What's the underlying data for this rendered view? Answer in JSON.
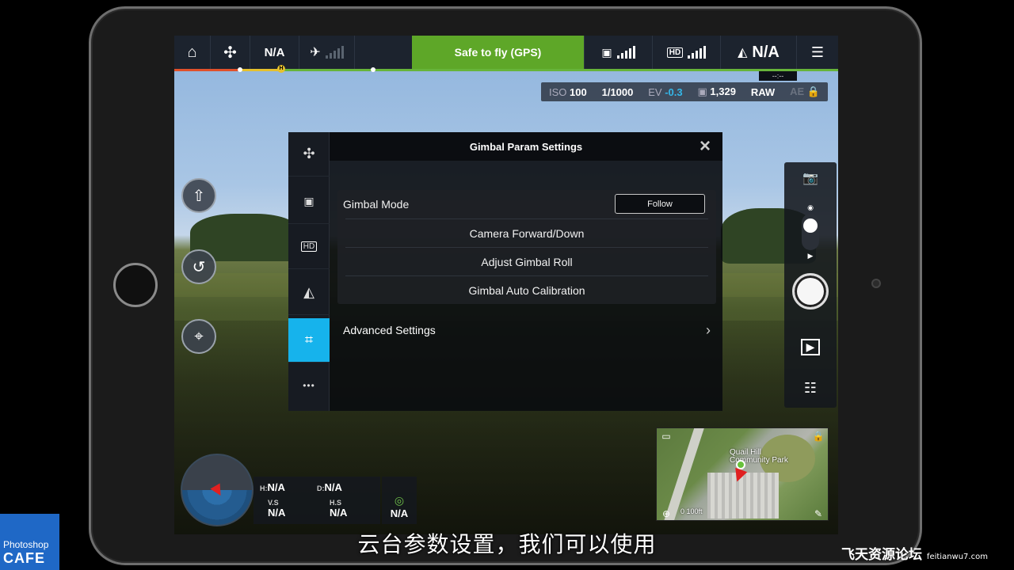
{
  "top_bar": {
    "flight_mode": "N/A",
    "status": "Safe to fly (GPS)",
    "altitude_mode": "N/A",
    "distance_tag": "--:--",
    "icons": [
      "home-icon",
      "aircraft-icon",
      "satellite-icon",
      "remote-controller-icon",
      "hd-icon",
      "vision-icon",
      "menu-icon"
    ]
  },
  "camera_bar": {
    "iso_label": "ISO",
    "iso_value": "100",
    "shutter": "1/1000",
    "ev_label": "EV",
    "ev_value": "-0.3",
    "capacity": "1,329",
    "format": "RAW",
    "ae": "AE"
  },
  "modal": {
    "title": "Gimbal Param Settings",
    "close": "×",
    "gimbal_mode_label": "Gimbal Mode",
    "gimbal_mode_value": "Follow",
    "rows": [
      "Camera Forward/Down",
      "Adjust Gimbal Roll",
      "Gimbal Auto Calibration"
    ],
    "advanced_label": "Advanced Settings",
    "chevron": "›",
    "side_tabs": [
      {
        "icon": "aircraft-icon",
        "label": "✣"
      },
      {
        "icon": "remote-controller-icon",
        "label": "🎮"
      },
      {
        "icon": "hd-icon",
        "label": "HD"
      },
      {
        "icon": "vision-icon",
        "label": "◭"
      },
      {
        "icon": "gimbal-icon",
        "label": "⌗"
      },
      {
        "icon": "more-icon",
        "label": "•••"
      }
    ]
  },
  "telemetry": {
    "h_label": "H:",
    "h_value": "N/A",
    "d_label": "D:",
    "d_value": "N/A",
    "vs_label": "V.S",
    "vs_value": "N/A",
    "hs_label": "H.S",
    "hs_value": "N/A",
    "signal_value": "N/A"
  },
  "map": {
    "label_line1": "Quail Hill",
    "label_line2": "Community Park",
    "scale": "0     100ft",
    "pin_letter": "H"
  },
  "subtitle": "云台参数设置，我们可以使用",
  "logo": {
    "line1": "Photoshop",
    "line2": "CAFE"
  },
  "watermark": {
    "main": "飞天资源论坛",
    "domain": "feitianwu7.com"
  },
  "colors": {
    "accent": "#16b3ec",
    "status_green": "#5ea728",
    "top_bar": "#1c232e"
  }
}
